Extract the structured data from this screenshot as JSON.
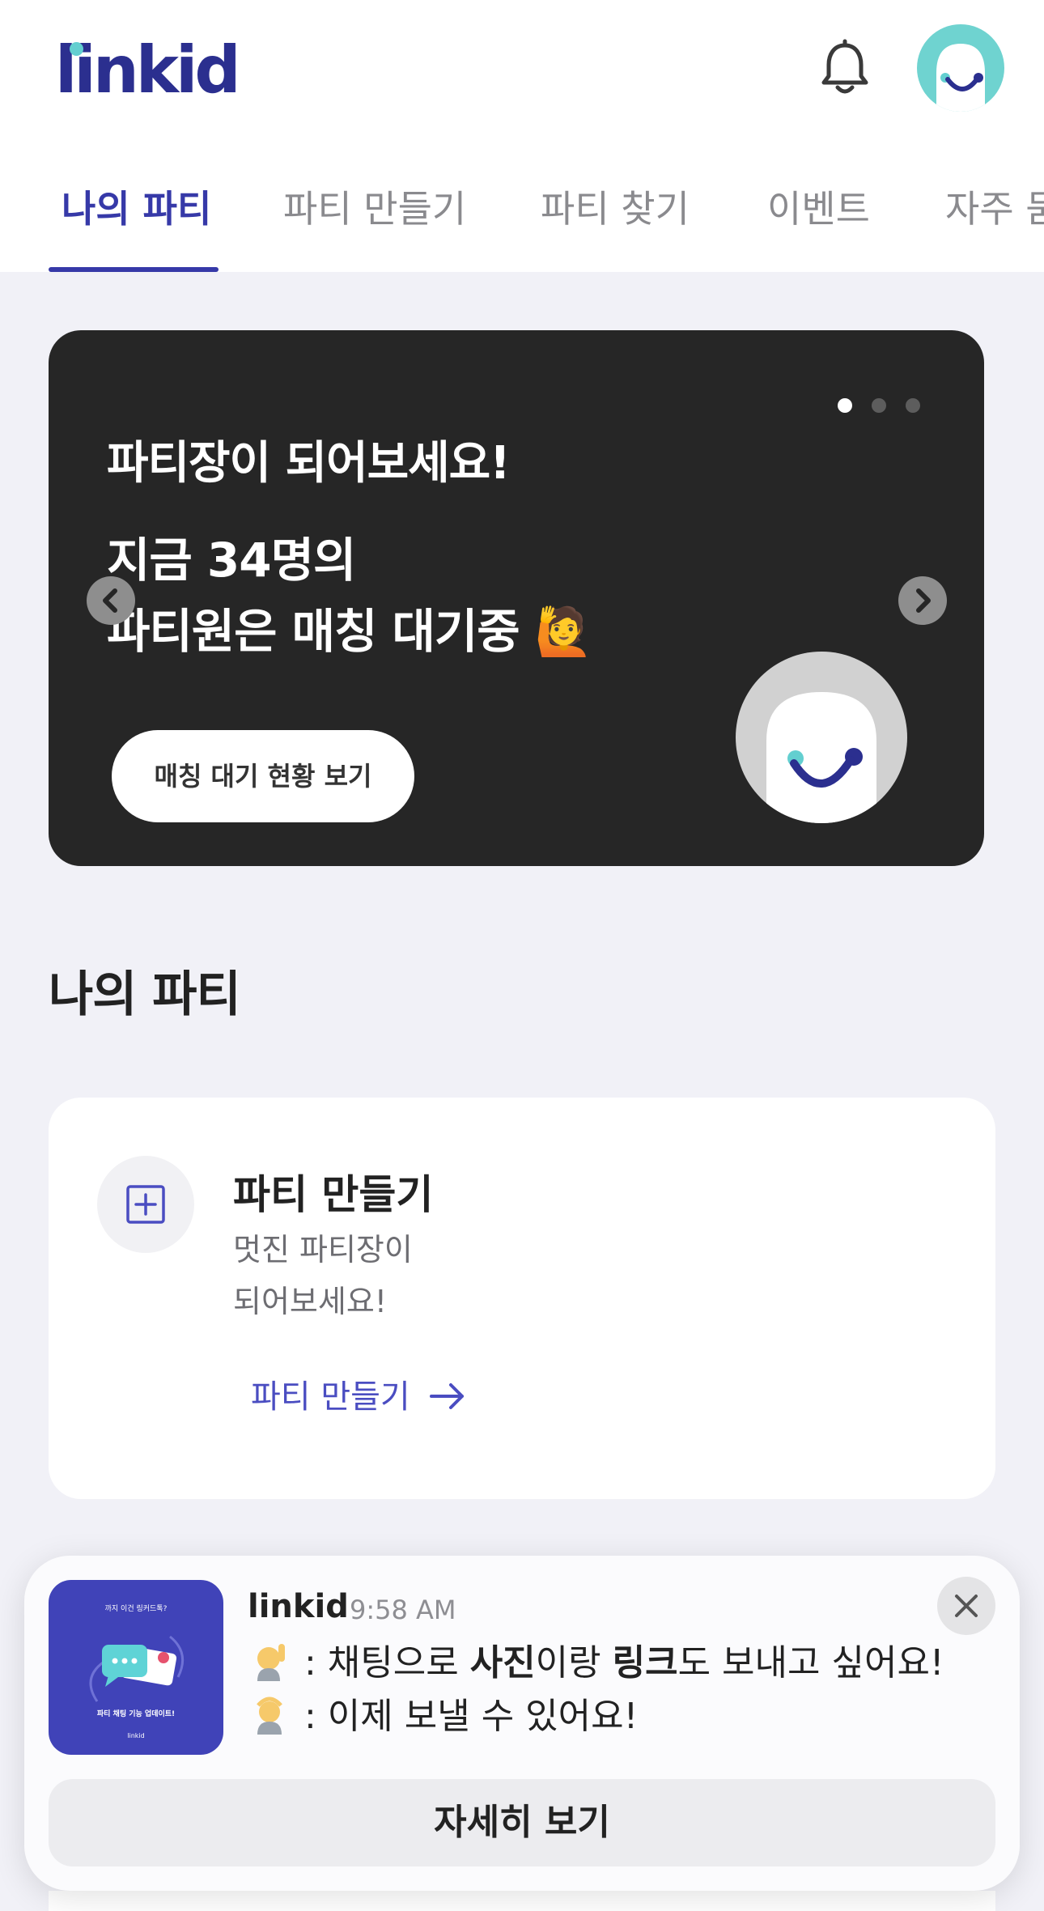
{
  "header": {
    "logo": "linkid",
    "colors": {
      "brand": "#2b2f8f",
      "accent": "#63cfd0"
    },
    "icons": {
      "bell": "bell-icon",
      "avatar": "profile-avatar"
    }
  },
  "tabs": [
    {
      "label": "나의 파티",
      "active": true
    },
    {
      "label": "파티 만들기",
      "active": false
    },
    {
      "label": "파티 찾기",
      "active": false
    },
    {
      "label": "이벤트",
      "active": false
    },
    {
      "label": "자주 묻는 질문",
      "active": false
    }
  ],
  "banner": {
    "title": "파티장이 되어보세요!",
    "line1": "지금 34명의",
    "line2": "파티원은 매칭 대기중 🙋",
    "button": "매칭 대기 현황 보기",
    "page_count": 3,
    "current_page": 1
  },
  "section": {
    "title": "나의 파티"
  },
  "create_card": {
    "title": "파티 만들기",
    "desc_line1": "멋진 파티장이",
    "desc_line2": "되어보세요!",
    "link": "파티 만들기"
  },
  "notification": {
    "app": "linkid",
    "time": "9:58 AM",
    "thumb_caption_top": "까지 이건 링커드톡?",
    "thumb_caption_mid": "파티 채팅 기능 업데이트!",
    "thumb_caption_bottom": "linkid",
    "line1_a": " : 채팅으로 ",
    "line1_b": "사진",
    "line1_c": "이랑 ",
    "line1_d": "링크",
    "line1_e": "도 보내고 싶어요!",
    "line2": " : 이제 보낼 수 있어요!",
    "button": "자세히 보기"
  }
}
